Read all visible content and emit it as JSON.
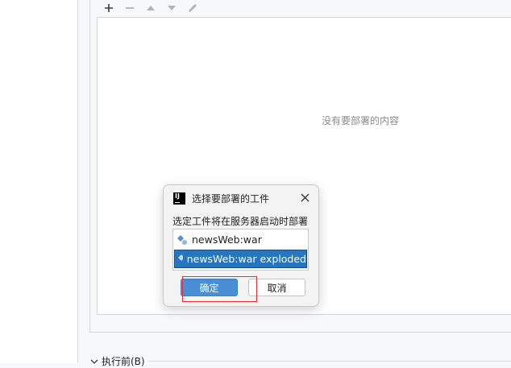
{
  "toolbar": {
    "add": "add-icon",
    "remove": "remove-icon",
    "move_up": "arrow-up-icon",
    "move_down": "arrow-down-icon",
    "edit": "pencil-icon"
  },
  "deployment": {
    "empty_text": "没有要部署的内容"
  },
  "before_launch": {
    "label": "执行前(B)"
  },
  "dialog": {
    "title": "选择要部署的工件",
    "app_icon_text": "IJ",
    "prompt": "选定工件将在服务器启动时部署",
    "artifacts": [
      "newsWeb:war",
      "newsWeb:war exploded"
    ],
    "selected_index": 1,
    "ok_label": "确定",
    "cancel_label": "取消"
  },
  "colors": {
    "selection": "#2675bf",
    "primary_button": "#4a8fd6",
    "highlight": "#e8302f"
  }
}
